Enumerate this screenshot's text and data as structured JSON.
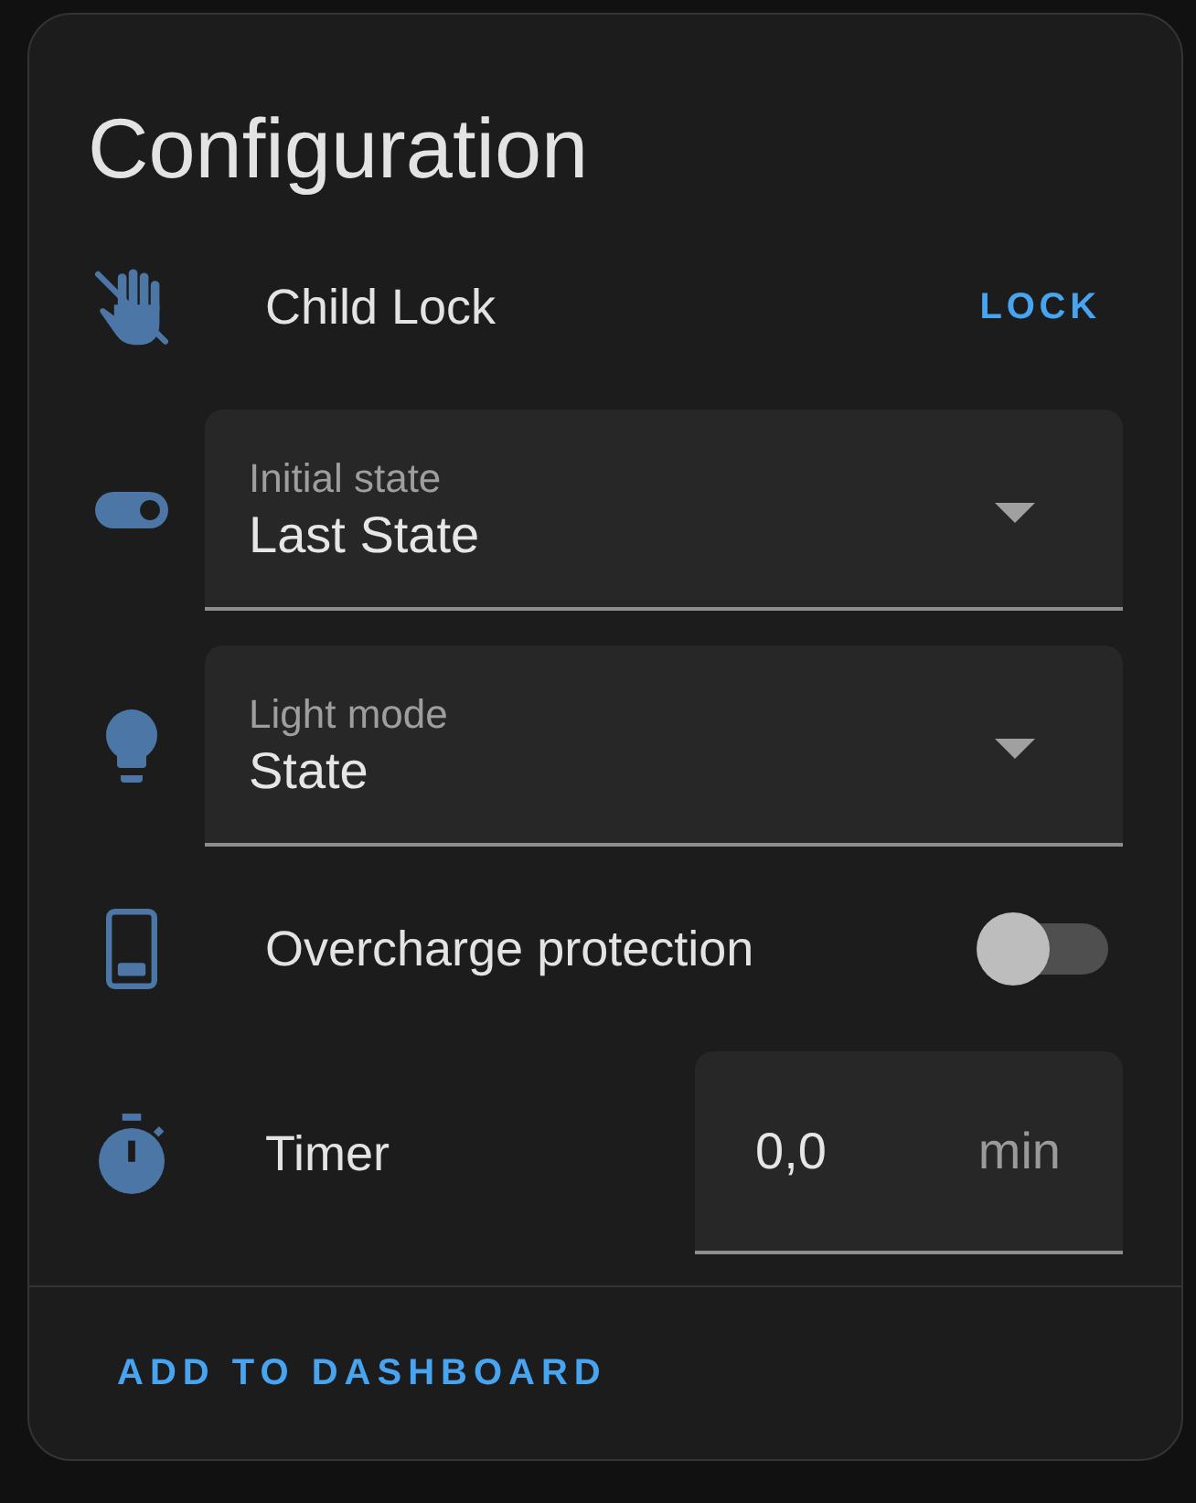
{
  "card": {
    "title": "Configuration"
  },
  "rows": [
    {
      "kind": "button",
      "label": "Child Lock",
      "button": "LOCK"
    },
    {
      "kind": "select",
      "label": "Initial state",
      "value": "Last State"
    },
    {
      "kind": "select",
      "label": "Light mode",
      "value": "State"
    },
    {
      "kind": "switch",
      "label": "Overcharge protection",
      "on": false
    },
    {
      "kind": "number",
      "label": "Timer",
      "value": "0,0",
      "unit": "min"
    }
  ],
  "footer": {
    "button": "ADD TO DASHBOARD"
  }
}
